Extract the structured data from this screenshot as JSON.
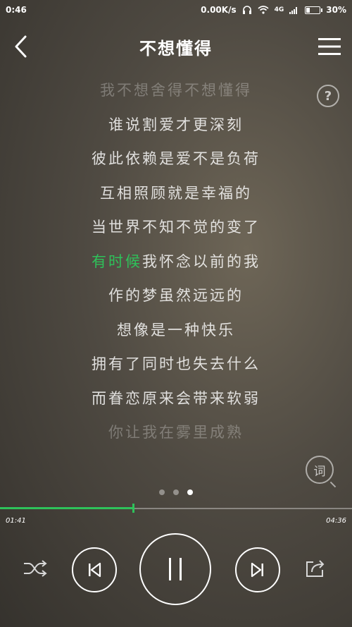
{
  "status_bar": {
    "time": "0:46",
    "net_speed": "0.00K/s",
    "signal": "4G",
    "battery": "30%"
  },
  "header": {
    "title": "不想懂得"
  },
  "help_label": "?",
  "lyrics": [
    "我不想舍得不想懂得",
    "谁说割爱才更深刻",
    "彼此依赖是爱不是负荷",
    "互相照顾就是幸福的",
    "当世界不知不觉的变了",
    "有时候我怀念以前的我",
    "作的梦虽然远远的",
    "想像是一种快乐",
    "拥有了同时也失去什么",
    "而眷恋原来会带来软弱",
    "你让我在雾里成熟"
  ],
  "active_line": {
    "highlighted": "有时候",
    "rest": "我怀念以前的我"
  },
  "lyric_button_label": "词",
  "pages": {
    "count": 3,
    "active": 2
  },
  "playback": {
    "current_time": "01:41",
    "total_time": "04:36",
    "progress": 0.377
  },
  "colors": {
    "accent": "#2ec25a"
  },
  "icons": {
    "back": "chevron-left-icon",
    "menu": "hamburger-menu-icon",
    "shuffle": "shuffle-icon",
    "previous": "previous-track-icon",
    "pause": "pause-icon",
    "next": "next-track-icon",
    "repeat": "repeat-icon"
  }
}
